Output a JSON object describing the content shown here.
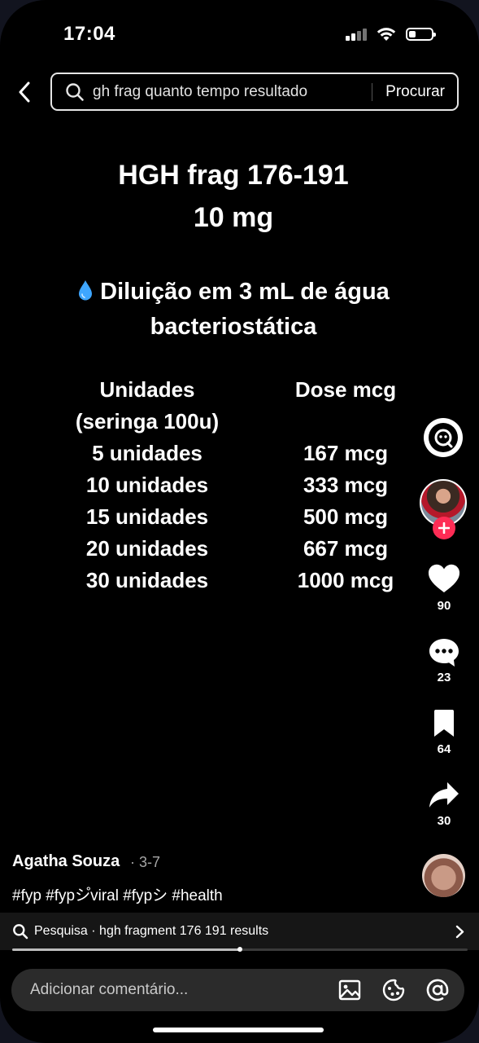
{
  "status_bar": {
    "time": "17:04",
    "battery_level": 0.3
  },
  "search": {
    "query": "gh frag quanto tempo resultado",
    "submit_label": "Procurar"
  },
  "video": {
    "title_line1": "HGH frag 176-191",
    "title_line2": "10 mg",
    "subtitle_icon": "water-drop-icon",
    "subtitle_line1": "Diluição em 3 mL de água",
    "subtitle_line2": "bacteriostática",
    "table": {
      "col1_header_line1": "Unidades",
      "col1_header_line2": "(seringa 100u)",
      "col2_header": "Dose mcg",
      "rows": [
        {
          "units": "5 unidades",
          "dose": "167 mcg"
        },
        {
          "units": "10 unidades",
          "dose": "333 mcg"
        },
        {
          "units": "15 unidades",
          "dose": "500 mcg"
        },
        {
          "units": "20 unidades",
          "dose": "667 mcg"
        },
        {
          "units": "30 unidades",
          "dose": "1000 mcg"
        }
      ]
    }
  },
  "actions": {
    "likes": "90",
    "comments": "23",
    "bookmarks": "64",
    "shares": "30"
  },
  "caption": {
    "author": "Agatha Souza",
    "date": "· 3-7",
    "hashtags": "#fyp #fypシ゚viral #fypシ #health"
  },
  "related_search": {
    "text": "Pesquisa · hgh fragment 176 191 results"
  },
  "playback": {
    "progress": 0.5
  },
  "comment_bar": {
    "placeholder": "Adicionar comentário..."
  },
  "colors": {
    "background": "#000000",
    "accent": "#fe2c55",
    "text": "#ffffff"
  }
}
